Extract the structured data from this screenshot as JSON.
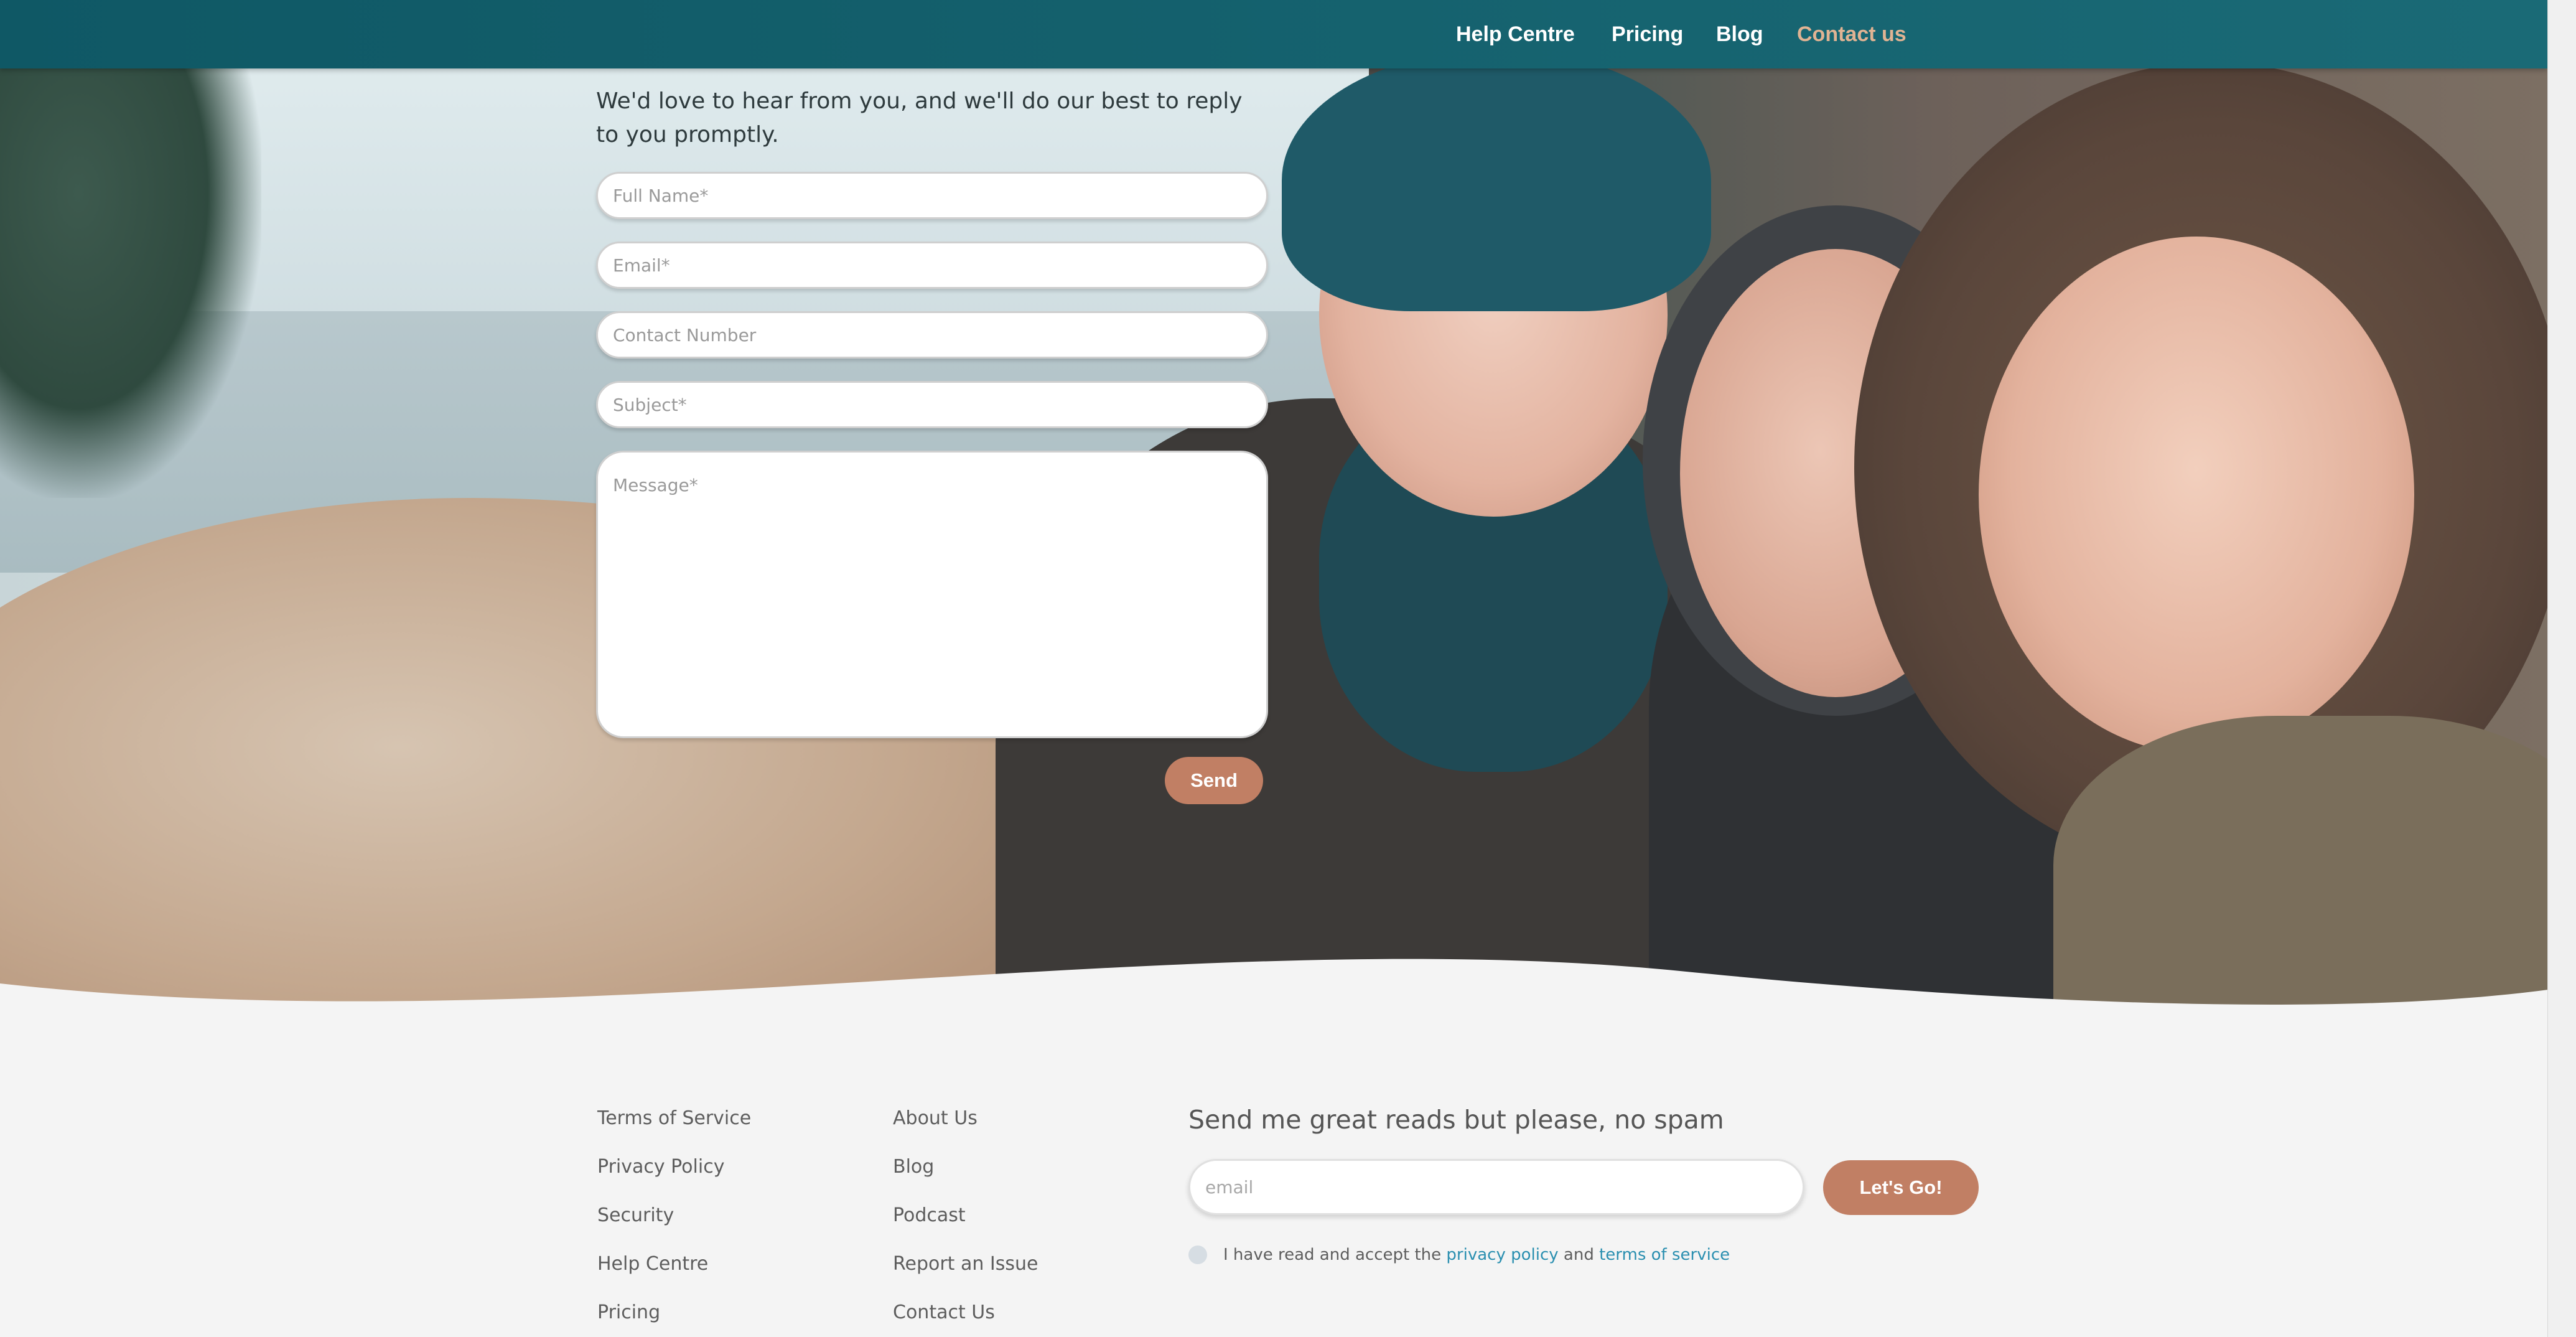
{
  "nav": {
    "items": [
      {
        "label": "Help Centre"
      },
      {
        "label": "Pricing"
      },
      {
        "label": "Blog"
      },
      {
        "label": "Contact us"
      }
    ],
    "active_color": "#e0b393"
  },
  "contact_form": {
    "intro": "We'd love to hear from you, and we'll do our best to reply to you promptly.",
    "full_name_placeholder": "Full Name*",
    "email_placeholder": "Email*",
    "contact_number_placeholder": "Contact Number",
    "subject_placeholder": "Subject*",
    "message_placeholder": "Message*",
    "send_label": "Send"
  },
  "footer": {
    "col1": [
      "Terms of Service",
      "Privacy Policy",
      "Security",
      "Help Centre",
      "Pricing"
    ],
    "col2": [
      "About Us",
      "Blog",
      "Podcast",
      "Report an Issue",
      "Contact Us"
    ],
    "newsletter": {
      "title": "Send me great reads but please, no spam",
      "email_placeholder": "email",
      "button_label": "Let's Go!",
      "consent_prefix": "I have read and accept the",
      "consent_link1": "privacy policy",
      "consent_and": "and",
      "consent_link2": "terms of service"
    }
  },
  "colors": {
    "header": "#146370",
    "button": "#c17f64",
    "link": "#2a8fb0"
  }
}
